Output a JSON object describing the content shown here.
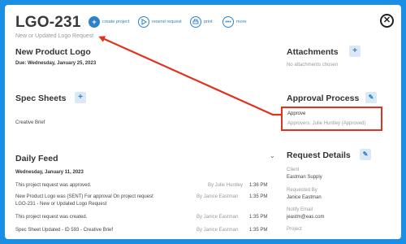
{
  "header": {
    "title": "LGO-231",
    "subtitle": "New or Updated Logo Request",
    "actions": [
      {
        "label": "create project",
        "icon": "plus-icon"
      },
      {
        "label": "resend request",
        "icon": "resend-icon"
      },
      {
        "label": "print",
        "icon": "print-icon"
      },
      {
        "label": "more",
        "icon": "more-icon"
      }
    ],
    "close_glyph": "✕"
  },
  "left": {
    "product": {
      "title": "New Product Logo",
      "due": "Due: Wednesday, January 25, 2023"
    },
    "spec": {
      "title": "Spec Sheets",
      "item": "Creative Brief"
    },
    "feed": {
      "title": "Daily Feed",
      "date": "Wednesday, January 11, 2023",
      "rows": [
        {
          "text": "This project request was approved.",
          "by": "By Julie Huntley",
          "time": "1:36 PM"
        },
        {
          "text": "New Product Logo was (SENT) For approval On project request",
          "text2": "LGO-231 - New or Updated Logo Request",
          "by": "By Janice Eastman",
          "time": "1:35 PM"
        },
        {
          "text": "This project request was created.",
          "by": "By Janice Eastman",
          "time": "1:35 PM"
        },
        {
          "text": "Spec Sheet Updated - ID 593 - Creative Brief",
          "by": "By Janice Eastman",
          "time": "1:35 PM"
        }
      ]
    }
  },
  "right": {
    "attachments": {
      "title": "Attachments",
      "empty": "No attachments chosen"
    },
    "approval": {
      "title": "Approval Process",
      "status": "Approve",
      "approvers": "Approvers: Julie Huntley (Approved)"
    },
    "details": {
      "title": "Request Details",
      "client_label": "Client",
      "client_value": "Eastman Supply",
      "requested_label": "Requested By",
      "requested_value": "Janice Eastman",
      "notify_label": "Notify Email",
      "notify_value": "jeastm@eas.com",
      "project_label": "Project"
    }
  },
  "colors": {
    "accent": "#2b82c9",
    "highlight": "#e0321c",
    "background": "#1a8fe3"
  }
}
